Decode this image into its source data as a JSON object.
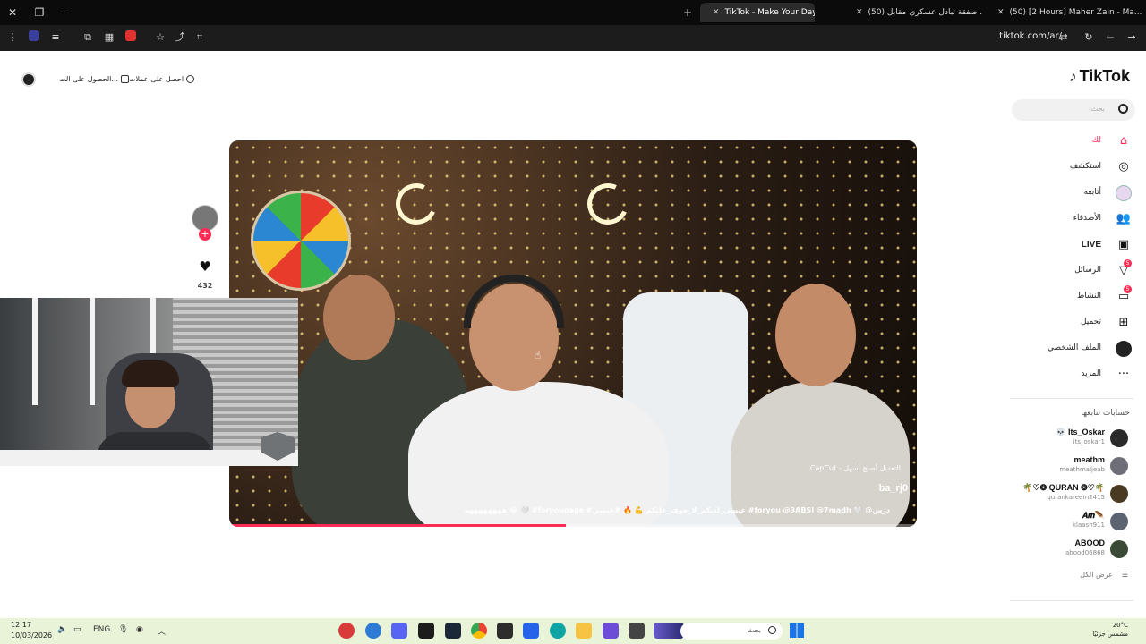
{
  "browser": {
    "tabs": [
      {
        "title": "TikTok - Make Your Day",
        "active": true
      },
      {
        "title": "(50) صفقة تبادل عسكري مقابل ...",
        "active": false
      },
      {
        "title": "(50) [2 Hours] Maher Zain - Ma...",
        "active": false
      }
    ],
    "url": "tiktok.com/ar/"
  },
  "page": {
    "top_links": {
      "get_coins": "احصل على عملات",
      "get_app": "الحصول على الت..."
    },
    "logo": "TikTok",
    "search_placeholder": "بحث",
    "nav": [
      {
        "label": "لك",
        "icon": "home-icon",
        "active": true
      },
      {
        "label": "استكشف",
        "icon": "compass-icon"
      },
      {
        "label": "أتابعه",
        "icon": "following-icon"
      },
      {
        "label": "الأصدقاء",
        "icon": "friends-icon"
      },
      {
        "label": "LIVE",
        "icon": "live-icon"
      },
      {
        "label": "الرسائل",
        "icon": "messages-icon",
        "badge": "5"
      },
      {
        "label": "النشاط",
        "icon": "activity-icon",
        "badge": "5"
      },
      {
        "label": "تحميل",
        "icon": "upload-icon"
      },
      {
        "label": "الملف الشخصي",
        "icon": "profile-icon"
      },
      {
        "label": "المزيد",
        "icon": "more-icon"
      }
    ],
    "following_title": "حسابات تتابعها",
    "following": [
      {
        "name": "💀 Its_Oskar",
        "handle": "its_oskar1"
      },
      {
        "name": "meathm",
        "handle": "meathmaljeab"
      },
      {
        "name": "🌴♡❂ QURAN ❂♡🌴",
        "handle": "qurankareem2415"
      },
      {
        "name": "𝑨𝒎🪶",
        "handle": "klaash911"
      },
      {
        "name": "ABOOD",
        "handle": "abood06868"
      }
    ],
    "see_all": "عرض الكل",
    "video": {
      "watermark": "CapCut - التعديل أصبح أسهل",
      "username": "ba_rj0",
      "caption": "ههههههههه 😂 🤍 #foryoupage #عيسى_لديكم_لا_خوف_عليكم 💪 🔥 #عيسي #foryou @3ABSI @7madh 🤍 @درس",
      "progress": 0.49
    },
    "like_count": "432"
  },
  "taskbar": {
    "time": "12:17",
    "date": "10/03/2026",
    "lang": "ENG",
    "search_placeholder": "بحث",
    "temp": "20°C",
    "weather": "مشمس جزئيًا"
  }
}
